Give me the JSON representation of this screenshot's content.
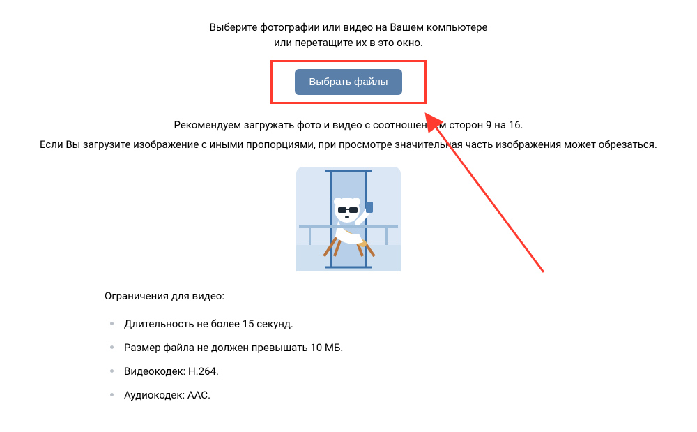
{
  "lead": {
    "line1": "Выберите фотографии или видео на Вашем компьютере",
    "line2": "или перетащите их в это окно."
  },
  "choose_button_label": "Выбрать файлы",
  "advice": {
    "line1": "Рекомендуем загружать фото и видео с соотношением сторон 9 на 16.",
    "line2": "Если Вы загрузите изображение с иными пропорциями, при просмотре значительная часть изображения может обрезаться."
  },
  "limits": {
    "title": "Ограничения для видео:",
    "items": [
      "Длительность не более 15 секунд.",
      "Размер файла не должен превышать 10 МБ.",
      "Видеокодек: H.264.",
      "Аудиокодек: AAC."
    ]
  },
  "annotation": {
    "color": "#ff3b30"
  }
}
